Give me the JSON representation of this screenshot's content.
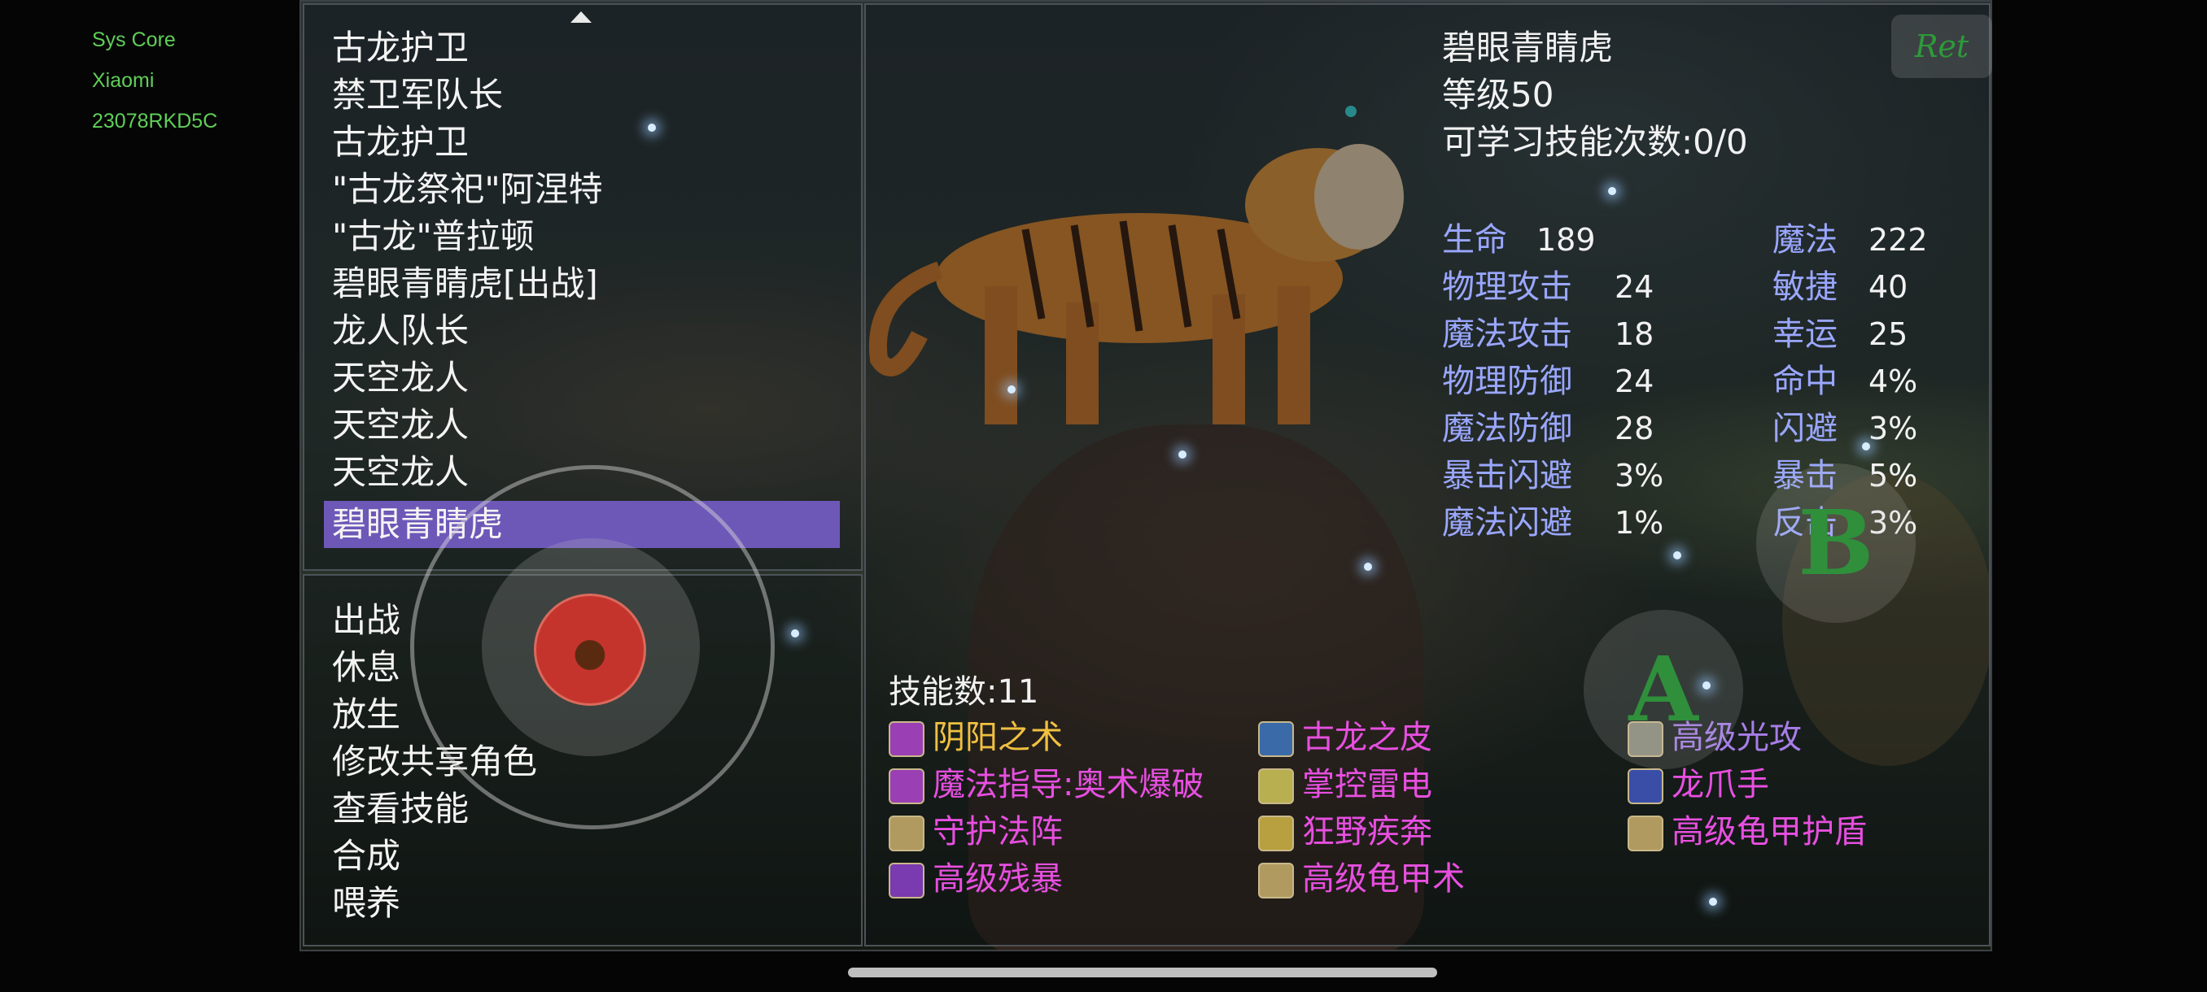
{
  "system_info": [
    "Sys Core",
    "Xiaomi",
    "23078RKD5C"
  ],
  "pet_list": {
    "items": [
      "古龙护卫",
      "禁卫军队长",
      "古龙护卫",
      "\"古龙祭祀\"阿涅特",
      "\"古龙\"普拉顿",
      "碧眼青睛虎[出战]",
      "龙人队长",
      "天空龙人",
      "天空龙人",
      "天空龙人",
      "碧眼青睛虎"
    ],
    "selected_index": 10
  },
  "actions": [
    "出战",
    "休息",
    "放生",
    "修改共享角色",
    "查看技能",
    "合成",
    "喂养"
  ],
  "pet": {
    "name": "碧眼青睛虎",
    "level": "等级50",
    "learnable_skills": "可学习技能次数:0/0",
    "stats_left": [
      {
        "name": "生命",
        "value": "189"
      },
      {
        "name": "物理攻击",
        "value": "24"
      },
      {
        "name": "魔法攻击",
        "value": "18"
      },
      {
        "name": "物理防御",
        "value": "24"
      },
      {
        "name": "魔法防御",
        "value": "28"
      },
      {
        "name": "暴击闪避",
        "value": "3%"
      },
      {
        "name": "魔法闪避",
        "value": "1%"
      }
    ],
    "stats_right": [
      {
        "name": "魔法",
        "value": "222"
      },
      {
        "name": "敏捷",
        "value": "40"
      },
      {
        "name": "幸运",
        "value": "25"
      },
      {
        "name": "命中",
        "value": "4%"
      },
      {
        "name": "闪避",
        "value": "3%"
      },
      {
        "name": "暴击",
        "value": "5%"
      },
      {
        "name": "反击",
        "value": "3%"
      }
    ]
  },
  "skills": {
    "count_label": "技能数:11",
    "list": [
      {
        "name": "阴阳之术",
        "color": "#f0c040",
        "icon": "yin-yang-icon",
        "icon_color": "#9b3fb5"
      },
      {
        "name": "古龙之皮",
        "color": "#e74fe0",
        "icon": "dragon-skin-icon",
        "icon_color": "#3a6aa8"
      },
      {
        "name": "高级光攻",
        "color": "#a77de8",
        "icon": "light-attack-icon",
        "icon_color": "#8c8c7a"
      },
      {
        "name": "魔法指导:奥术爆破",
        "color": "#e74fe0",
        "icon": "arcane-guide-icon",
        "icon_color": "#9b3fb5"
      },
      {
        "name": "掌控雷电",
        "color": "#e74fe0",
        "icon": "lightning-icon",
        "icon_color": "#b8b050"
      },
      {
        "name": "龙爪手",
        "color": "#e74fe0",
        "icon": "dragon-claw-icon",
        "icon_color": "#3a4ea8"
      },
      {
        "name": "守护法阵",
        "color": "#e74fe0",
        "icon": "guard-circle-icon",
        "icon_color": "#b09a60"
      },
      {
        "name": "狂野疾奔",
        "color": "#e74fe0",
        "icon": "wild-dash-icon",
        "icon_color": "#b8a040"
      },
      {
        "name": "高级龟甲护盾",
        "color": "#e74fe0",
        "icon": "turtle-shield-icon",
        "icon_color": "#b09a60"
      },
      {
        "name": "高级残暴",
        "color": "#e74fe0",
        "icon": "brutality-icon",
        "icon_color": "#7a3ab0"
      },
      {
        "name": "高级龟甲术",
        "color": "#e74fe0",
        "icon": "turtle-shell-icon",
        "icon_color": "#b09a60"
      }
    ]
  },
  "controls": {
    "ret_label": "Ret",
    "button_b": "B",
    "button_a": "A"
  },
  "colors": {
    "stat_name": "#9aa7ff",
    "selected_bg": "#6d58b8",
    "sys_text": "#5fcf58"
  }
}
